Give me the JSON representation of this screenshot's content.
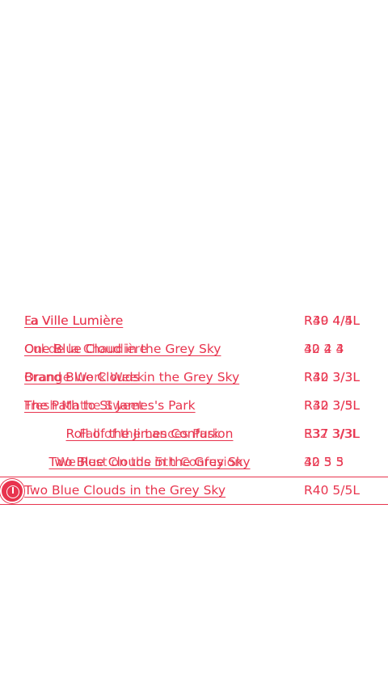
{
  "routes": [
    {
      "name": "Fa Ville Lumière",
      "ghost": "La ville Lumière",
      "grade": "R40 4/4L",
      "ghost_grade": "R39 4/5L",
      "align": "left",
      "selected": false
    },
    {
      "name": "One Blue Cloud in the Grey Sky",
      "ghost": "Cul de la Chaudière",
      "grade": "40 4 4",
      "ghost_grade": "32 2 3",
      "align": "left",
      "selected": false
    },
    {
      "name": "Brand Blue Clouds in the Grey Sky",
      "ghost": "Orange Work Week",
      "grade": "R40 3/3L",
      "ghost_grade": "R32 3/3L",
      "align": "left",
      "selected": false
    },
    {
      "name": "The Path to St James's Park",
      "ghost": "Fresh Mathe Sweet",
      "grade": "R32 3/5L",
      "ghost_grade": "R40 3/3L",
      "align": "left",
      "selected": false
    },
    {
      "name": "Roll of the Jimes Confusion",
      "ghost": "Fall of the Lances Park",
      "grade": "R37 3/3L",
      "ghost_grade": "E32 3/3L",
      "align": "center",
      "selected": false
    },
    {
      "name": "Two Blue Clouds in the Grey Sky",
      "ghost": "We Rest on the 5th Confusion",
      "grade": "40 5  5",
      "ghost_grade": "32 3 3",
      "align": "center",
      "selected": false
    },
    {
      "name": "Two Blue Clouds in the Grey Sky",
      "ghost": "",
      "grade": "R40 5/5L",
      "ghost_grade": "",
      "align": "left",
      "selected": true,
      "icon": "location-pin-icon"
    }
  ],
  "colors": {
    "accent": "#e8344e",
    "background": "#ffffff"
  }
}
